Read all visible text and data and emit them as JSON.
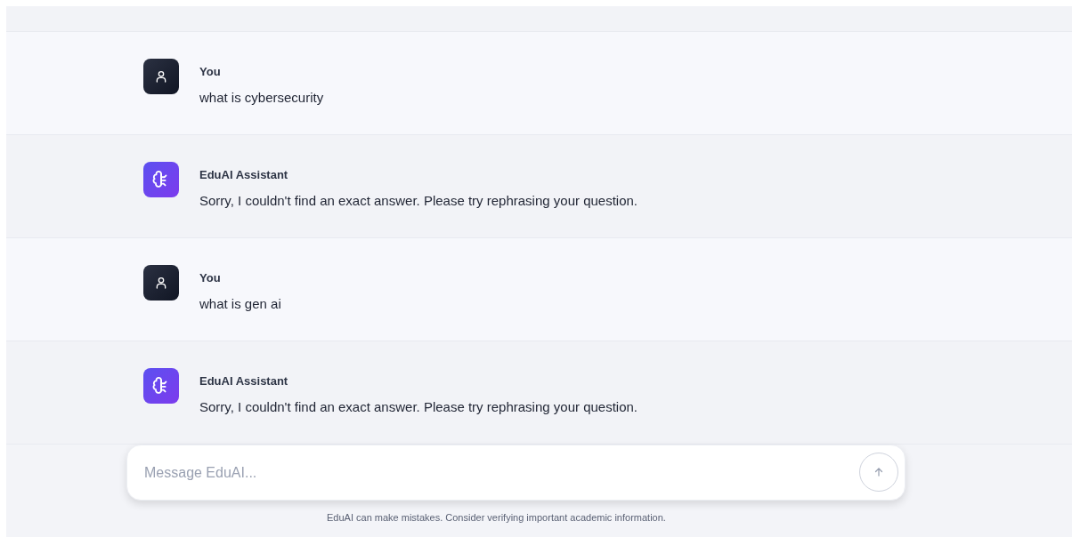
{
  "messages": [
    {
      "kind": "user",
      "sender": "You",
      "text": "what is cybersecurity"
    },
    {
      "kind": "assistant",
      "sender": "EduAI Assistant",
      "text": "Sorry, I couldn't find an exact answer. Please try rephrasing your question."
    },
    {
      "kind": "user",
      "sender": "You",
      "text": "what is gen ai"
    },
    {
      "kind": "assistant",
      "sender": "EduAI Assistant",
      "text": "Sorry, I couldn't find an exact answer. Please try rephrasing your question."
    }
  ],
  "composer": {
    "placeholder": "Message EduAI..."
  },
  "disclaimer": "EduAI can make mistakes. Consider verifying important academic information."
}
